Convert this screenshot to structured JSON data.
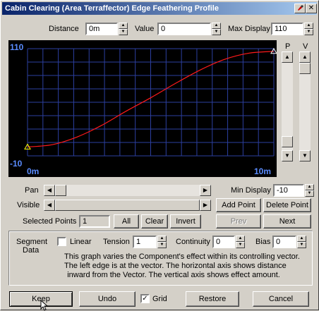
{
  "window": {
    "title": "Cabin Clearing (Area Terraffector) Edge Feathering Profile"
  },
  "top_fields": {
    "distance_label": "Distance",
    "distance_value": "0m",
    "value_label": "Value",
    "value_value": "0",
    "max_display_label": "Max Display",
    "max_display_value": "110"
  },
  "graph": {
    "y_max_label": "110",
    "y_min_label": "-10",
    "x_min_label": "0m",
    "x_max_label": "10m",
    "grid": true,
    "colors": {
      "background": "#000000",
      "grid": "#2c3fa0",
      "curve": "#ff1a1a",
      "axis_text": "#5a8cff",
      "point": "#ffff00"
    }
  },
  "right_scrollbars": {
    "p_label": "P",
    "v_label": "V"
  },
  "pan_label": "Pan",
  "visible_label": "Visible",
  "min_display_label": "Min Display",
  "min_display_value": "-10",
  "buttons": {
    "add_point": "Add Point",
    "delete_point": "Delete Point",
    "all": "All",
    "clear": "Clear",
    "invert": "Invert",
    "prev": "Prev",
    "next": "Next",
    "keep": "Keep",
    "undo": "Undo",
    "restore": "Restore",
    "cancel": "Cancel"
  },
  "selected_points_label": "Selected Points",
  "selected_points_value": "1",
  "segment": {
    "segment_data_line1": "Segment",
    "segment_data_line2": "Data",
    "linear_label": "Linear",
    "linear_checked": false,
    "tension_label": "Tension",
    "tension_value": "1",
    "continuity_label": "Continuity",
    "continuity_value": "0",
    "bias_label": "Bias",
    "bias_value": "0"
  },
  "description": [
    "This graph varies the Component's effect within its controlling vector.",
    "The left edge is at the vector. The horizontal axis shows distance",
    "inward from the Vector. The vertical axis shows effect amount."
  ],
  "grid_label": "Grid",
  "grid_checked": true,
  "chart_data": {
    "type": "line",
    "x": [
      0,
      1,
      2,
      3,
      4,
      5,
      6,
      7,
      8,
      9,
      10
    ],
    "y": [
      0,
      2.5,
      11,
      24,
      40,
      55,
      71,
      86,
      98,
      105,
      107
    ],
    "control_points": [
      {
        "x": 0,
        "y": 0
      },
      {
        "x": 10,
        "y": 107
      }
    ],
    "xlim": [
      0,
      10
    ],
    "ylim": [
      -10,
      110
    ],
    "x_unit": "m",
    "grid": true
  }
}
